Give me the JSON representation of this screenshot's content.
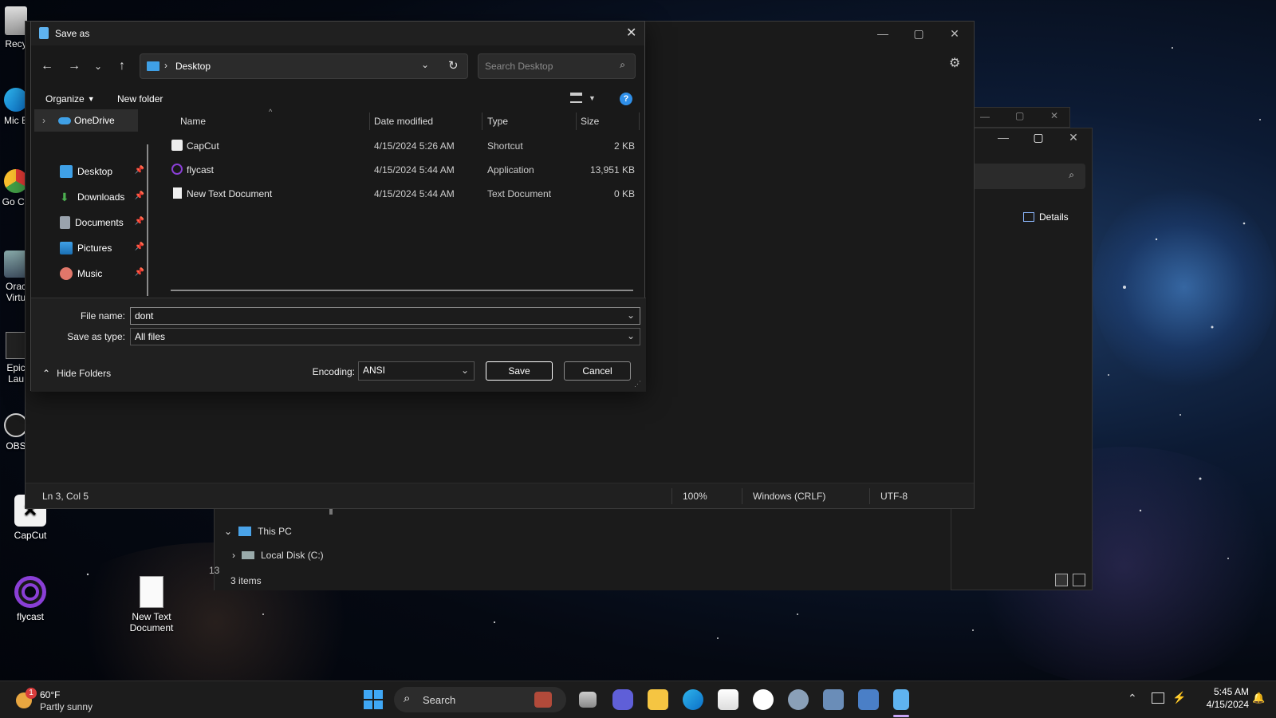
{
  "desktop": {
    "icons": [
      {
        "label": "Recy"
      },
      {
        "label": "Mic E"
      },
      {
        "label": "Go Ch"
      },
      {
        "label": "Orac Virtu"
      },
      {
        "label": "Epic Lau"
      },
      {
        "label": "OBS"
      },
      {
        "label": "CapCut"
      },
      {
        "label": "flycast"
      },
      {
        "label": "New Text Document"
      }
    ]
  },
  "notepad": {
    "status": {
      "position": "Ln 3, Col 5",
      "zoom": "100%",
      "line_ending": "Windows (CRLF)",
      "encoding": "UTF-8"
    }
  },
  "explorer": {
    "search_partial": "op",
    "details_label": "Details",
    "nav": {
      "this_pc": "This PC",
      "local_disk": "Local Disk (C:)"
    },
    "status_items": "3 items",
    "partial_num": "13"
  },
  "dialog": {
    "title": "Save as",
    "address": {
      "location": "Desktop"
    },
    "search_placeholder": "Search Desktop",
    "toolbar": {
      "organize": "Organize",
      "new_folder": "New folder"
    },
    "nav_pane": {
      "onedrive": "OneDrive",
      "items": [
        {
          "label": "Desktop",
          "icon": "desktop-icon"
        },
        {
          "label": "Downloads",
          "icon": "downloads-icon"
        },
        {
          "label": "Documents",
          "icon": "documents-icon"
        },
        {
          "label": "Pictures",
          "icon": "pictures-icon"
        },
        {
          "label": "Music",
          "icon": "music-icon"
        }
      ]
    },
    "columns": {
      "name": "Name",
      "date": "Date modified",
      "type": "Type",
      "size": "Size"
    },
    "files": [
      {
        "name": "CapCut",
        "date": "4/15/2024 5:26 AM",
        "type": "Shortcut",
        "size": "2 KB"
      },
      {
        "name": "flycast",
        "date": "4/15/2024 5:44 AM",
        "type": "Application",
        "size": "13,951 KB"
      },
      {
        "name": "New Text Document",
        "date": "4/15/2024 5:44 AM",
        "type": "Text Document",
        "size": "0 KB"
      }
    ],
    "file_name_label": "File name:",
    "file_name_value": "dont",
    "save_type_label": "Save as type:",
    "save_type_value": "All files",
    "hide_folders": "Hide Folders",
    "encoding_label": "Encoding:",
    "encoding_value": "ANSI",
    "save_button": "Save",
    "cancel_button": "Cancel"
  },
  "taskbar": {
    "weather_temp": "60°F",
    "weather_desc": "Partly sunny",
    "weather_badge": "1",
    "search_label": "Search",
    "time": "5:45 AM",
    "date": "4/15/2024"
  }
}
